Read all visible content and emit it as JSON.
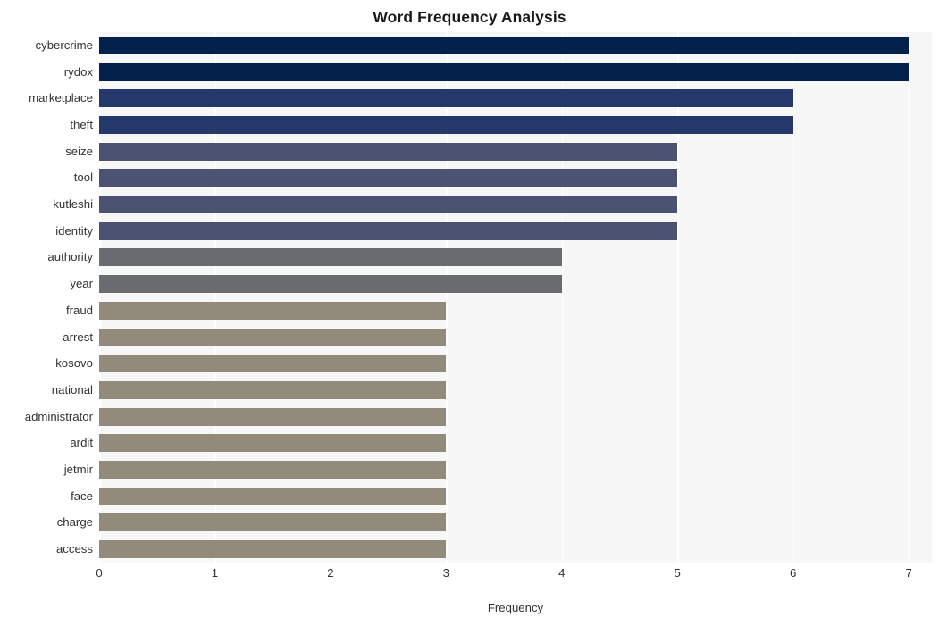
{
  "chart_data": {
    "type": "bar",
    "orientation": "horizontal",
    "title": "Word Frequency Analysis",
    "xlabel": "Frequency",
    "ylabel": "",
    "xlim": [
      0,
      7.2
    ],
    "grid": true,
    "legend": false,
    "xticks": [
      "0",
      "1",
      "2",
      "3",
      "4",
      "5",
      "6",
      "7"
    ],
    "xtick_values": [
      0,
      1,
      2,
      3,
      4,
      5,
      6,
      7
    ],
    "categories": [
      "cybercrime",
      "rydox",
      "marketplace",
      "theft",
      "seize",
      "tool",
      "kutleshi",
      "identity",
      "authority",
      "year",
      "fraud",
      "arrest",
      "kosovo",
      "national",
      "administrator",
      "ardit",
      "jetmir",
      "face",
      "charge",
      "access"
    ],
    "values": [
      7,
      7,
      6,
      6,
      5,
      5,
      5,
      5,
      4,
      4,
      3,
      3,
      3,
      3,
      3,
      3,
      3,
      3,
      3,
      3
    ],
    "bar_colors": [
      "#03214a",
      "#03214a",
      "#25386c",
      "#25386c",
      "#4c5272",
      "#4c5272",
      "#4c5272",
      "#4c5272",
      "#6b6c72",
      "#6b6c72",
      "#928b7b",
      "#928b7b",
      "#928b7b",
      "#928b7b",
      "#928b7b",
      "#928b7b",
      "#928b7b",
      "#928b7b",
      "#928b7b",
      "#928b7b"
    ],
    "plot_background": "#f7f7f7",
    "gridline_color": "#ffffff",
    "page_background": "#ffffff",
    "title_color": "#1a1a1a",
    "tick_color": "#333333"
  }
}
